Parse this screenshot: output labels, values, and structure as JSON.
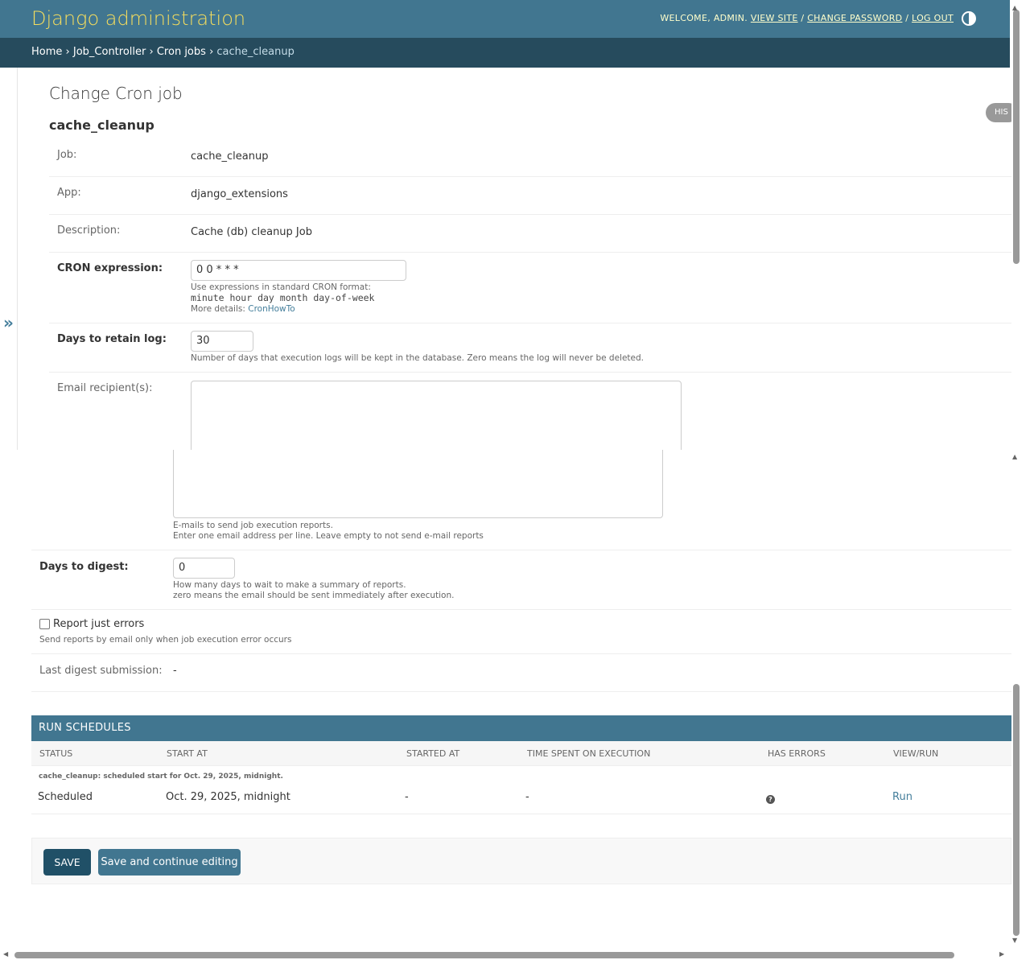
{
  "header": {
    "site_title": "Django administration",
    "welcome": "WELCOME,",
    "username": "ADMIN",
    "view_site": "VIEW SITE",
    "change_password": "CHANGE PASSWORD",
    "log_out": "LOG OUT"
  },
  "breadcrumbs": {
    "home": "Home",
    "app": "Job_Controller",
    "model": "Cron jobs",
    "current": "cache_cleanup",
    "separator": "›"
  },
  "sidebar": {
    "toggle_label": "»"
  },
  "page": {
    "title": "Change Cron job",
    "object_title": "cache_cleanup",
    "history_label": "HIS"
  },
  "fields": {
    "job": {
      "label": "Job:",
      "value": "cache_cleanup"
    },
    "app": {
      "label": "App:",
      "value": "django_extensions"
    },
    "description": {
      "label": "Description:",
      "value": "Cache (db) cleanup Job"
    },
    "cron_expression": {
      "label": "CRON expression:",
      "value": "0 0 * * *",
      "help_line1": "Use expressions in standard CRON format:",
      "help_code": "minute hour day month day-of-week",
      "help_more": "More details:",
      "help_link": "CronHowTo"
    },
    "days_retain_log": {
      "label": "Days to retain log:",
      "value": "30",
      "help": "Number of days that execution logs will be kept in the database. Zero means the log will never be deleted."
    },
    "email_recipients": {
      "label": "Email recipient(s):",
      "value": "",
      "help_line1": "E-mails to send job execution reports.",
      "help_line2": "Enter one email address per line. Leave empty to not send e-mail reports"
    },
    "days_to_digest": {
      "label": "Days to digest:",
      "value": "0",
      "help_line1": "How many days to wait to make a summary of reports.",
      "help_line2": "zero means the email should be sent immediately after execution."
    },
    "report_just_errors": {
      "label": "Report just errors",
      "checked": false,
      "help": "Send reports by email only when job execution error occurs"
    },
    "last_digest": {
      "label": "Last digest submission:",
      "value": "-"
    }
  },
  "run_schedules": {
    "caption": "RUN SCHEDULES",
    "columns": [
      "STATUS",
      "START AT",
      "STARTED AT",
      "TIME SPENT ON EXECUTION",
      "HAS ERRORS",
      "VIEW/RUN"
    ],
    "object_title": "cache_cleanup: scheduled start for Oct. 29, 2025, midnight.",
    "rows": [
      {
        "status": "Scheduled",
        "start_at": "Oct. 29, 2025, midnight",
        "started_at": "-",
        "time_spent": "-",
        "has_errors_icon": "question-circle-icon",
        "action": "Run"
      }
    ]
  },
  "submit": {
    "save": "SAVE",
    "save_continue": "Save and continue editing"
  },
  "colors": {
    "header_bg": "#417690",
    "breadcrumb_bg": "#264b5d",
    "brand_yellow": "#f5dd5d",
    "save_button": "#205067",
    "link": "#447e9b"
  }
}
